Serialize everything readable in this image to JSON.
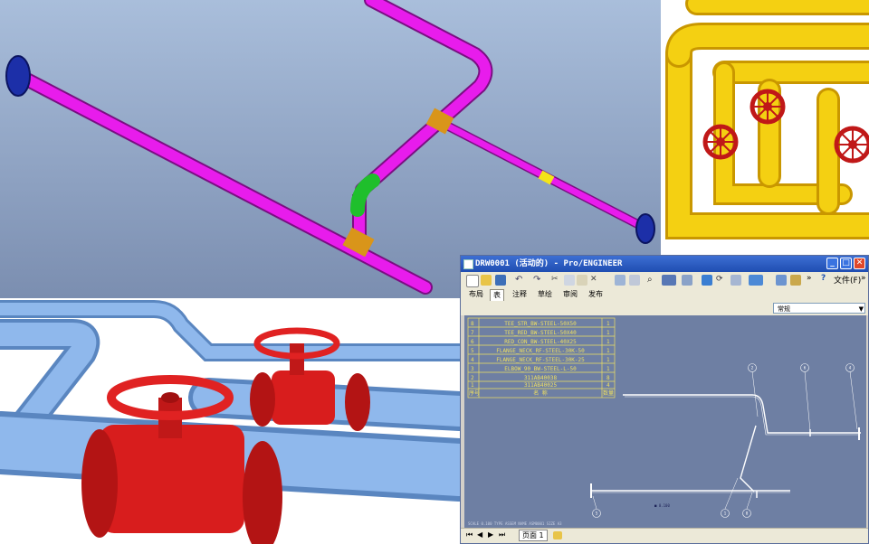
{
  "window": {
    "title": "DRW0001 (活动的) - Pro/ENGINEER",
    "menu_file": "文件(F)",
    "more": "»"
  },
  "ribbon": {
    "tabs": [
      "布局",
      "表",
      "注释",
      "草绘",
      "审阅",
      "发布"
    ],
    "active_tab": "表"
  },
  "filter": {
    "selected": "常规"
  },
  "bom_table": {
    "rows": [
      {
        "no": "8",
        "name": "TEE_STR_BW-STEEL-50X50",
        "qty": "1"
      },
      {
        "no": "7",
        "name": "TEE_RED_BW-STEEL-50X40",
        "qty": "1"
      },
      {
        "no": "6",
        "name": "RED_CON_BW-STEEL-40X25",
        "qty": "1"
      },
      {
        "no": "5",
        "name": "FLANGE_NECK_RF-STEEL-30K-50",
        "qty": "1"
      },
      {
        "no": "4",
        "name": "FLANGE_NECK_RF-STEEL-30K-25",
        "qty": "1"
      },
      {
        "no": "3",
        "name": "ELBOW_90_BW-STEEL-L-50",
        "qty": "1"
      },
      {
        "no": "2",
        "name": "311AB40038",
        "qty": "8"
      },
      {
        "no": "1",
        "name": "311AB40025",
        "qty": "4"
      }
    ],
    "header": {
      "no": "序号",
      "name": "名 称",
      "qty": "数量"
    }
  },
  "drawing": {
    "scale_label": "■ 0.100",
    "balloons": [
      "2",
      "6",
      "4",
      "5",
      "1",
      "8"
    ],
    "footer_note": "SCALE 0.100   TYPE ASSEM   NAME ASM0001   SIZE A3"
  },
  "statusbar": {
    "nav": [
      "⏮",
      "◀",
      "▶",
      "⏭"
    ],
    "page_label": "页面 1"
  },
  "colors": {
    "pipe_magenta": "#e81cec",
    "pipe_yellow": "#f4d012",
    "valve_red": "#d81d1d",
    "pipe_blue": "#7ba8e0",
    "canvas_blue": "#6e7fa3",
    "titlebar_blue": "#2457c5"
  }
}
